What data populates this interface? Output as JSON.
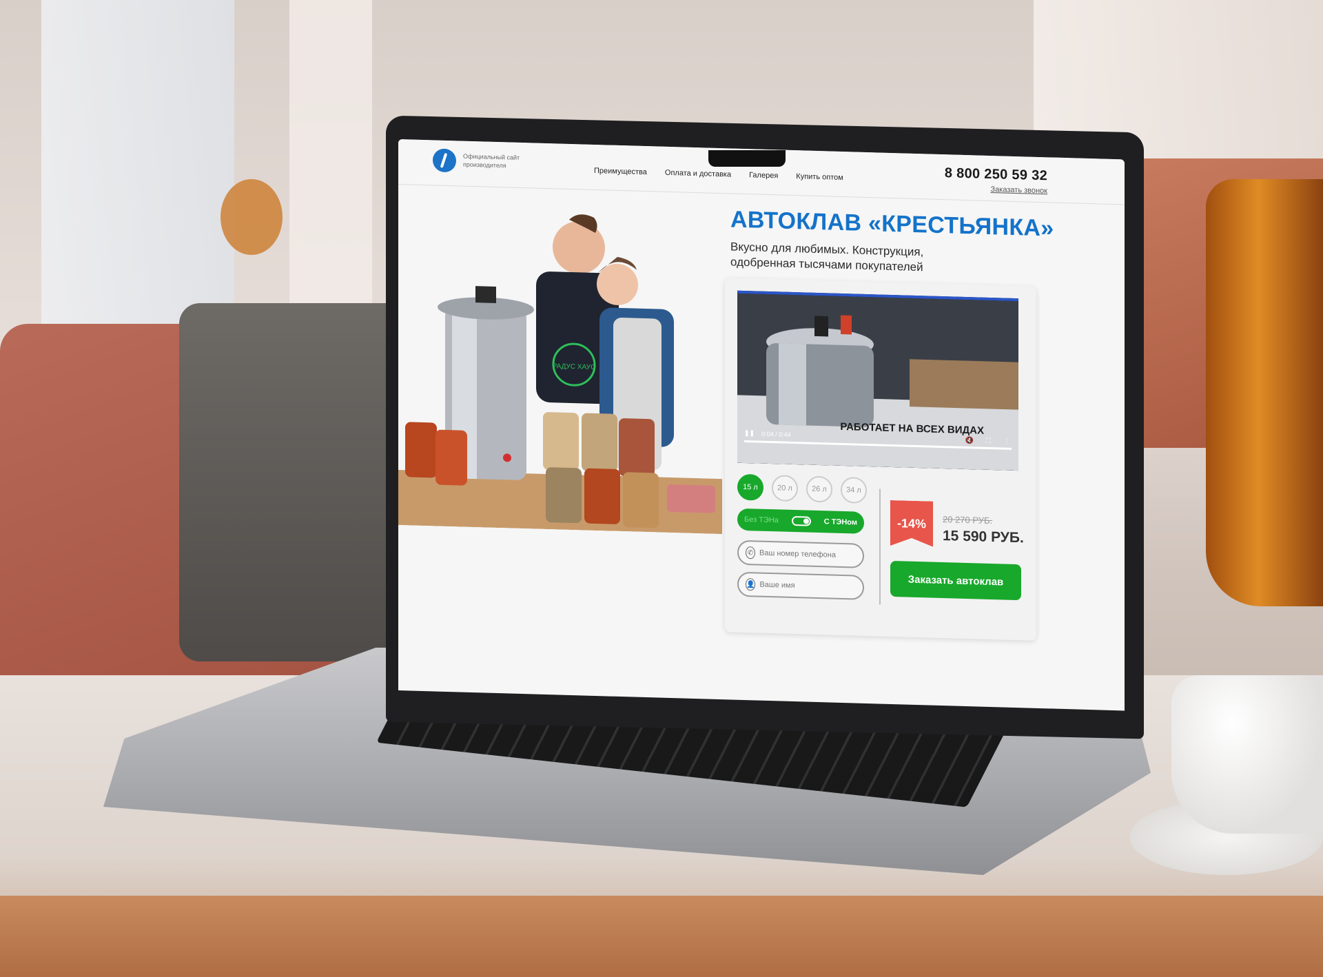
{
  "header": {
    "logo_caption": "Официальный сайт производителя",
    "nav": [
      {
        "label": "Преимущества"
      },
      {
        "label": "Оплата и доставка"
      },
      {
        "label": "Галерея"
      },
      {
        "label": "Купить оптом"
      }
    ],
    "phone": "8 800 250 59 32",
    "callback_link": "Заказать звонок"
  },
  "hero": {
    "title": "АВТОКЛАВ «КРЕСТЬЯНКА»",
    "subtitle": "Вкусно для любимых. Конструкция, одобренная тысячами покупателей",
    "apron_text": "РАДУС ХАУС"
  },
  "video": {
    "time": "0:04 / 0:44",
    "overlay_text": "РАБОТАЕТ НА ВСЕХ ВИДАХ",
    "progress": 1.0,
    "icons": [
      "pause-icon",
      "mute-icon",
      "fullscreen-icon",
      "more-icon"
    ]
  },
  "order": {
    "volumes": [
      "15 л",
      "20 л",
      "26 л",
      "34 л"
    ],
    "selected_volume": "15 л",
    "heater_off_label": "Без ТЭНа",
    "heater_on_label": "С ТЭНом",
    "phone_placeholder": "Ваш номер телефона",
    "name_placeholder": "Ваше имя",
    "discount": "-14%",
    "old_price": "20 270 РУБ.",
    "new_price": "15 590 РУБ.",
    "cta_label": "Заказать автоклав"
  },
  "colors": {
    "brand_blue": "#1473c9",
    "accent_green": "#18a82b",
    "discount_red": "#e8554a"
  }
}
